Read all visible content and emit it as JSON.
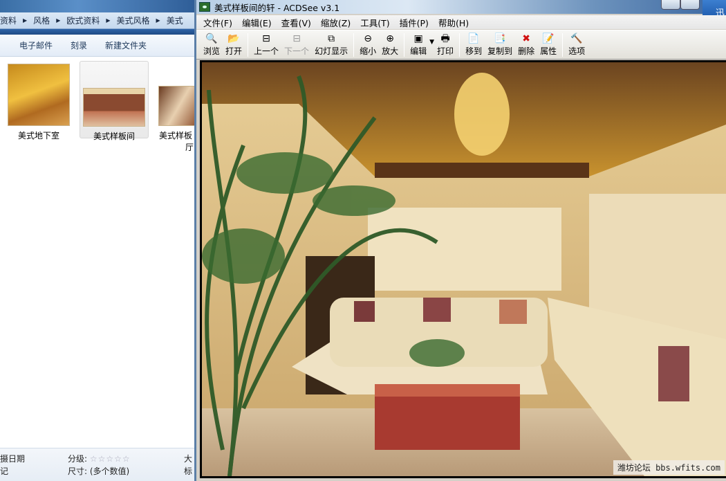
{
  "explorer": {
    "breadcrumb": [
      "资料",
      "风格",
      "欧式资料",
      "美式风格",
      "美式"
    ],
    "toolbar": [
      "电子邮件",
      "刻录",
      "新建文件夹"
    ],
    "files": [
      {
        "label": "美式地下室",
        "selected": false
      },
      {
        "label": "美式样板间",
        "selected": true
      },
      {
        "label": "美式样板",
        "label2": "厅",
        "selected": false
      }
    ],
    "details": {
      "date_label": "摄日期",
      "line2_label": "记",
      "rating_label": "分级:",
      "rating": 0,
      "rating_max": 5,
      "size_label": "尺寸:",
      "size_value": "(多个数值)",
      "right1": "大",
      "right2": "标"
    }
  },
  "acdsee": {
    "title": "美式样板间的轩 - ACDSee v3.1",
    "menu": [
      "文件(F)",
      "编辑(E)",
      "查看(V)",
      "缩放(Z)",
      "工具(T)",
      "插件(P)",
      "帮助(H)"
    ],
    "toolbar": [
      {
        "label": "浏览",
        "icon": "browse-icon",
        "glyph": "🔍"
      },
      {
        "label": "打开",
        "icon": "open-folder-icon",
        "glyph": "📂"
      },
      {
        "sep": true
      },
      {
        "label": "上一个",
        "icon": "previous-icon",
        "glyph": "⊟"
      },
      {
        "label": "下一个",
        "icon": "next-icon",
        "glyph": "⊟",
        "disabled": true
      },
      {
        "label": "幻灯显示",
        "icon": "slideshow-icon",
        "glyph": "⧉"
      },
      {
        "sep": true
      },
      {
        "label": "缩小",
        "icon": "zoom-out-icon",
        "glyph": "⊖"
      },
      {
        "label": "放大",
        "icon": "zoom-in-icon",
        "glyph": "⊕"
      },
      {
        "sep": true
      },
      {
        "label": "编辑",
        "icon": "edit-icon",
        "glyph": "▣",
        "dropdown": true
      },
      {
        "label": "打印",
        "icon": "print-icon",
        "glyph": "🖶"
      },
      {
        "sep": true
      },
      {
        "label": "移到",
        "icon": "move-to-icon",
        "glyph": "📄"
      },
      {
        "label": "复制到",
        "icon": "copy-to-icon",
        "glyph": "📑"
      },
      {
        "label": "删除",
        "icon": "delete-icon",
        "glyph": "✖"
      },
      {
        "label": "属性",
        "icon": "properties-icon",
        "glyph": "📝"
      },
      {
        "sep": true
      },
      {
        "label": "选项",
        "icon": "options-icon",
        "glyph": "🔨"
      }
    ],
    "watermark": "潍坊论坛 bbs.wfits.com"
  },
  "tray": {
    "thunder_label": "迅"
  },
  "colors": {
    "delete": "#d01010",
    "accent": "#2f5e98"
  }
}
